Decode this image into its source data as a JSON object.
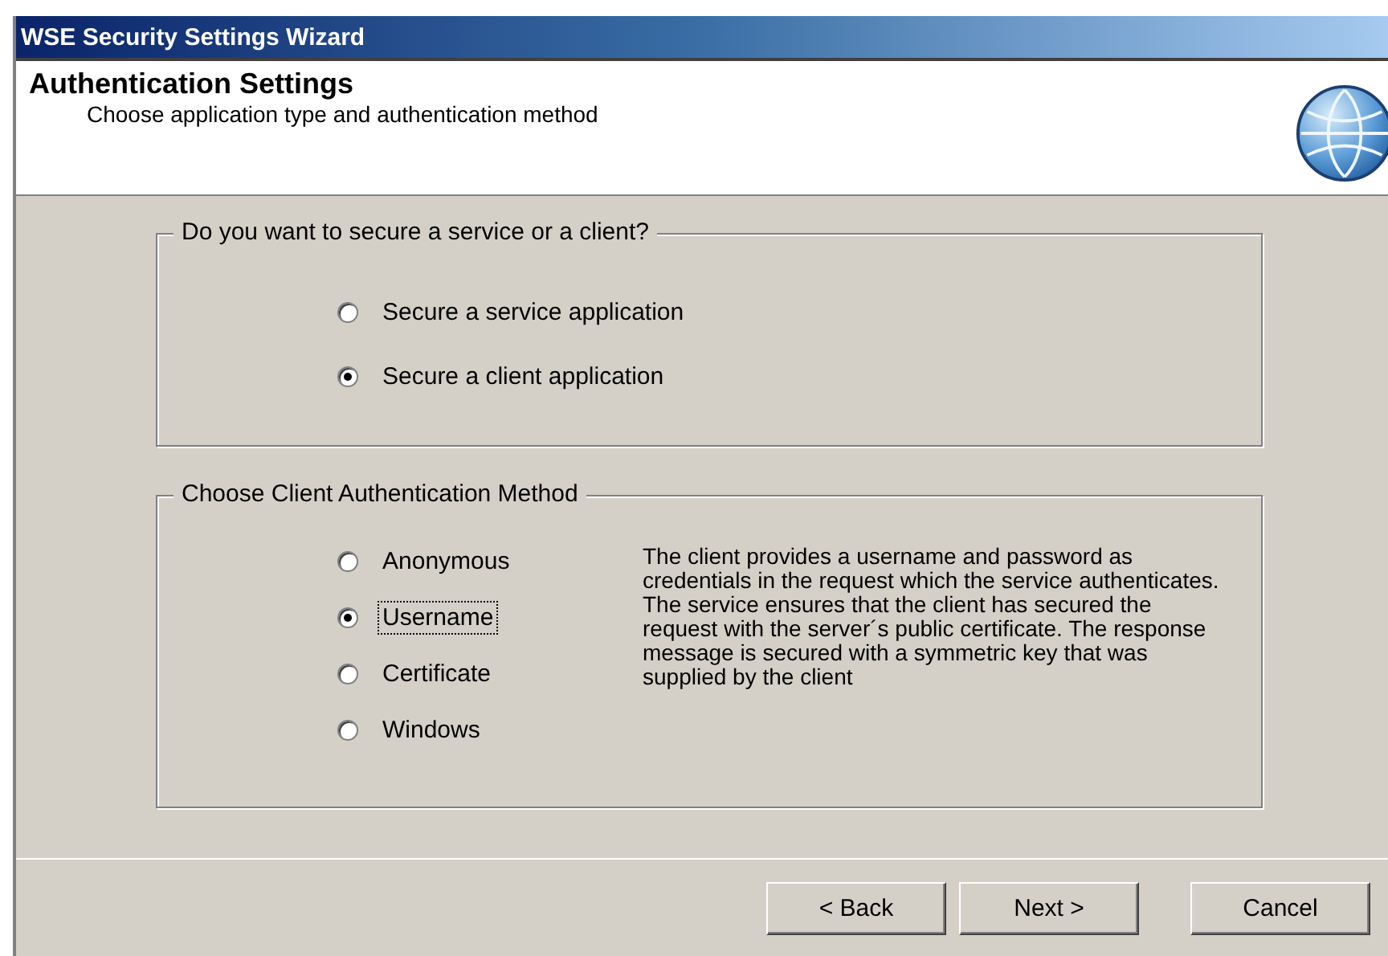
{
  "window": {
    "title": "WSE Security Settings Wizard"
  },
  "header": {
    "title": "Authentication Settings",
    "subtitle": "Choose application type and authentication method"
  },
  "groups": [
    {
      "title": "Do you want to secure a service or a client?",
      "options": [
        {
          "label": "Secure a service application",
          "selected": false,
          "focused": false
        },
        {
          "label": "Secure a client application",
          "selected": true,
          "focused": false
        }
      ]
    },
    {
      "title": "Choose Client Authentication Method",
      "options": [
        {
          "label": "Anonymous",
          "selected": false,
          "focused": false
        },
        {
          "label": "Username",
          "selected": true,
          "focused": true
        },
        {
          "label": "Certificate",
          "selected": false,
          "focused": false
        },
        {
          "label": "Windows",
          "selected": false,
          "focused": false
        }
      ],
      "description": "The client provides a username and password as credentials in the request which the service authenticates. The service ensures that the client has secured the request with the server´s public certificate. The response message is secured with a symmetric key that was supplied by the client"
    }
  ],
  "buttons": [
    "< Back",
    "Next >",
    "Cancel"
  ]
}
